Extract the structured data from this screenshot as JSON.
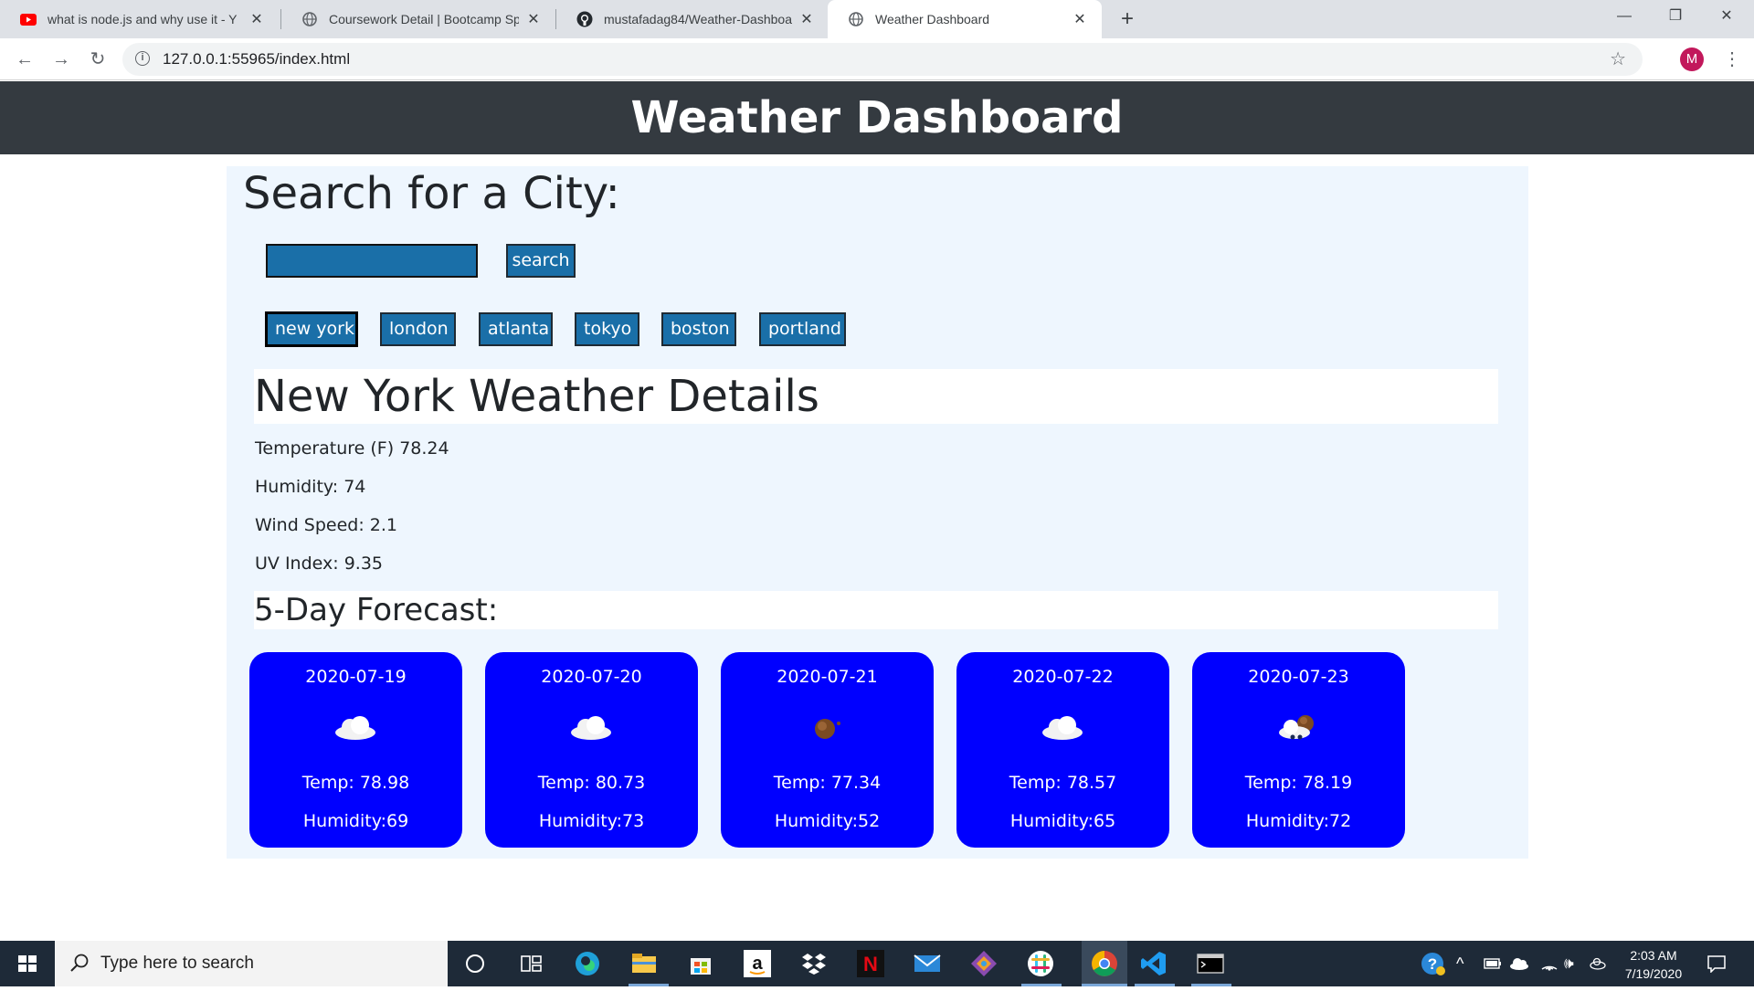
{
  "browser": {
    "tabs": [
      {
        "title": "what is node.js and why use it - Y",
        "icon": "youtube-icon"
      },
      {
        "title": "Coursework Detail | Bootcamp Sp",
        "icon": "globe-icon"
      },
      {
        "title": "mustafadag84/Weather-Dashboa",
        "icon": "github-icon"
      },
      {
        "title": "Weather Dashboard",
        "icon": "globe-icon"
      }
    ],
    "url": "127.0.0.1:55965/index.html",
    "profile_initial": "M",
    "window_controls": {
      "minimize": "—",
      "restore": "❐",
      "close": "✕"
    }
  },
  "page": {
    "header_title": "Weather Dashboard",
    "search_title": "Search for a City:",
    "search_button": "search",
    "search_value": "",
    "cities": [
      "new york",
      "london",
      "atlanta",
      "tokyo",
      "boston",
      "portland"
    ],
    "details": {
      "title": "New York Weather Details",
      "temperature": "Temperature (F) 78.24",
      "humidity": "Humidity: 74",
      "wind": "Wind Speed: 2.1",
      "uv": "UV Index: 9.35"
    },
    "forecast_title": "5-Day Forecast:",
    "forecast": [
      {
        "date": "2020-07-19",
        "icon": "cloud-icon",
        "temp": "Temp: 78.98",
        "humidity": "Humidity:69"
      },
      {
        "date": "2020-07-20",
        "icon": "cloud-icon",
        "temp": "Temp: 80.73",
        "humidity": "Humidity:73"
      },
      {
        "date": "2020-07-21",
        "icon": "sun-icon",
        "temp": "Temp: 77.34",
        "humidity": "Humidity:52"
      },
      {
        "date": "2020-07-22",
        "icon": "cloud-icon",
        "temp": "Temp: 78.57",
        "humidity": "Humidity:65"
      },
      {
        "date": "2020-07-23",
        "icon": "rain-cloud-icon",
        "temp": "Temp: 78.19",
        "humidity": "Humidity:72"
      }
    ]
  },
  "taskbar": {
    "search_placeholder": "Type here to search",
    "time": "2:03 AM",
    "date": "7/19/2020"
  },
  "colors": {
    "header_bg": "#343a40",
    "panel_bg": "#eef6fe",
    "button_bg": "#1a6fa8",
    "card_bg": "#0000ff"
  }
}
